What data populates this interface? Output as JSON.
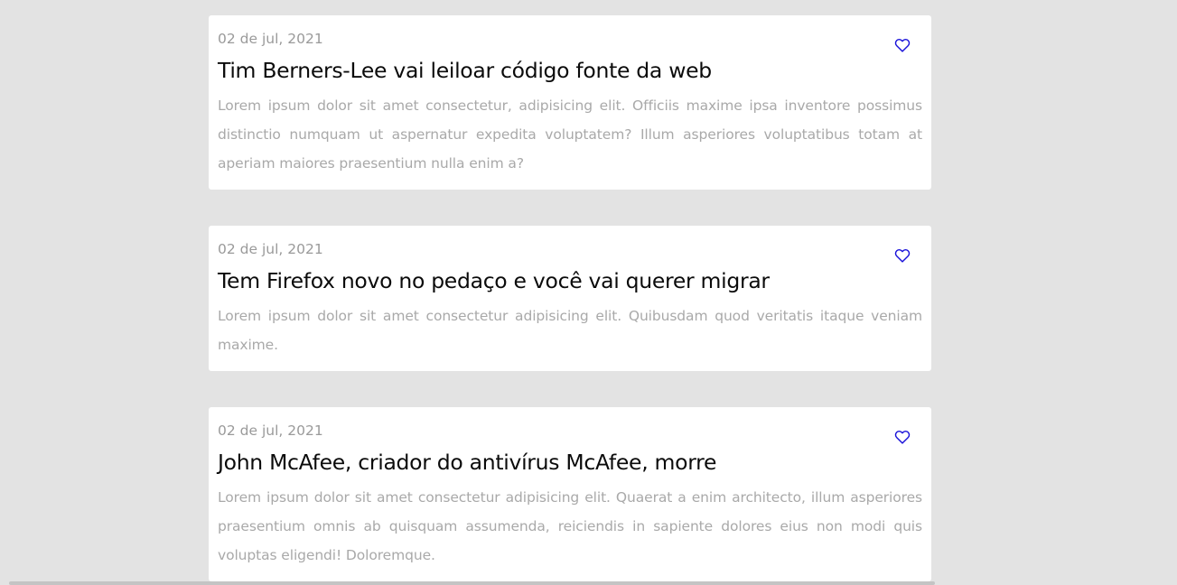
{
  "colors": {
    "background": "#e3e3e3",
    "card": "#ffffff",
    "heart": "#1a12d9",
    "date": "#9a9a9a",
    "body": "#a9a9a9"
  },
  "posts": [
    {
      "date": "02 de jul, 2021",
      "title": "Tim Berners-Lee vai leiloar código fonte da web",
      "body": "Lorem ipsum dolor sit amet consectetur, adipisicing elit. Officiis maxime ipsa inventore possimus distinctio numquam ut aspernatur expedita voluptatem? Illum asperiores voluptatibus totam at aperiam maiores praesentium nulla enim a?",
      "icon": "heart-outline-icon"
    },
    {
      "date": "02 de jul, 2021",
      "title": "Tem Firefox novo no pedaço e você vai querer migrar",
      "body": "Lorem ipsum dolor sit amet consectetur adipisicing elit. Quibusdam quod veritatis itaque veniam maxime.",
      "icon": "heart-outline-icon"
    },
    {
      "date": "02 de jul, 2021",
      "title": "John McAfee, criador do antivírus McAfee, morre",
      "body": "Lorem ipsum dolor sit amet consectetur adipisicing elit. Quaerat a enim architecto, illum asperiores praesentium omnis ab quisquam assumenda, reiciendis in sapiente dolores eius non modi quis voluptas eligendi! Doloremque.",
      "icon": "heart-outline-icon"
    }
  ]
}
